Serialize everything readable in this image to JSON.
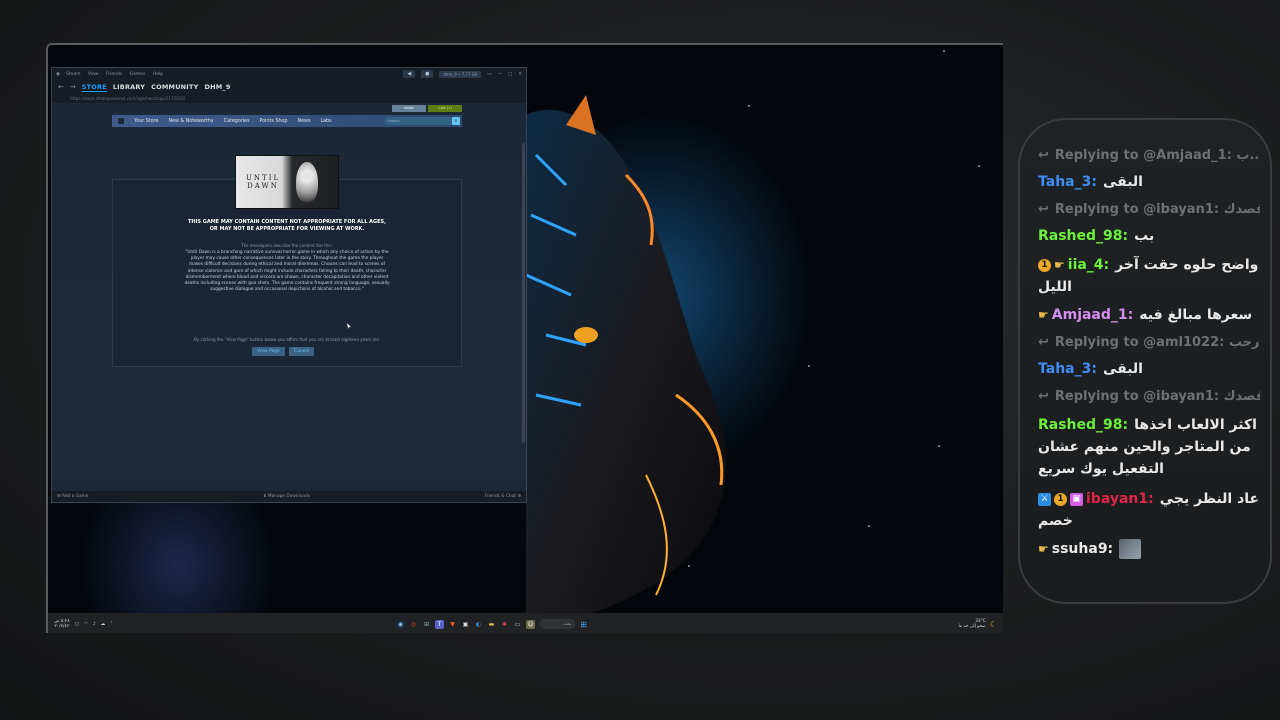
{
  "steam": {
    "menu": [
      "Steam",
      "View",
      "Friends",
      "Games",
      "Help"
    ],
    "user_chip": "dhm_9 • 7,77 SR",
    "nav": [
      "STORE",
      "LIBRARY",
      "COMMUNITY",
      "DHM_9"
    ],
    "url": "https://store.steampowered.com/agecheck/app/2172010/",
    "top_buttons": {
      "install": "Install",
      "cart": "Cart (1)"
    },
    "storenav": [
      "Your Store",
      "New & Noteworthy",
      "Categories",
      "Points Shop",
      "News",
      "Labs"
    ],
    "search_placeholder": "search",
    "game_logo": "UNTIL DAWN",
    "warning_line1": "THIS GAME MAY CONTAIN CONTENT NOT APPROPRIATE FOR ALL AGES,",
    "warning_line2": "OR MAY NOT BE APPROPRIATE FOR VIEWING AT WORK.",
    "desc_head": "The developers describe the content like this:",
    "description": "\"Until Dawn is a branching narrative survival horror game in which any choice of action by the player may cause other consequences later in the story. Throughout the game the player makes difficult decisions during ethical and moral dilemmas. Choices can lead to scenes of intense violence and gore of which might include characters falling to their death, character dismemberment where blood and viscera are shown, character decapitation and other violent deaths including scenes with gun shots. The game contains frequent strong language, sexually suggestive dialogue and occasional depictions of alcohol and tobacco.\"",
    "affirm": "By clicking the \"View Page\" button below you affirm that you are at least eighteen years old.",
    "view_page": "View Page",
    "cancel": "Cancel",
    "bottom_left": "Add a Game",
    "bottom_mid": "Manage Downloads",
    "bottom_right": "Friends & Chat"
  },
  "taskbar": {
    "time": "٥:٢٨ ص",
    "date": "٢٠/٨/٤٢",
    "search_text": "بحث",
    "weather_temp": "33°C",
    "weather_desc": "صحو إلى حد ما"
  },
  "chat": {
    "lines": [
      {
        "type": "reply",
        "text": "Replying to @Amjaad_1: ب..."
      },
      {
        "type": "msg",
        "user": "Taha_3:",
        "color": "#3d8df5",
        "msg": "البقى",
        "badges": []
      },
      {
        "type": "reply",
        "text": "Replying to @ibayan1: قصدك..."
      },
      {
        "type": "msg",
        "user": "Rashed_98:",
        "color": "#6cf23a",
        "msg": "بب",
        "badges": []
      },
      {
        "type": "msg",
        "user": "iia_4:",
        "color": "#6cf23a",
        "msg": "واضح حلوه حقت آخر الليل",
        "badges": [
          "one",
          "hand"
        ],
        "wrap": true
      },
      {
        "type": "msg",
        "user": "Amjaad_1:",
        "color": "#d58ef0",
        "msg": "سعرها مبالغ فيه",
        "badges": [
          "hand"
        ]
      },
      {
        "type": "reply",
        "text": "Replying to @aml1022: ارحب..."
      },
      {
        "type": "msg",
        "user": "Taha_3:",
        "color": "#3d8df5",
        "msg": "البقى",
        "badges": []
      },
      {
        "type": "reply",
        "text": "Replying to @ibayan1: قصدك..."
      },
      {
        "type": "msg",
        "user": "Rashed_98:",
        "color": "#6cf23a",
        "msg": "اكثر الالعاب اخذها من المتاجر والحين منهم عشان التفعيل يوك سريع",
        "badges": [],
        "wrap": true
      },
      {
        "type": "msg",
        "user": "ibayan1:",
        "color": "#e02547",
        "msg": "عاد النظر يجي خصم",
        "badges": [
          "sword",
          "one",
          "gift"
        ],
        "wrap": true
      },
      {
        "type": "msg",
        "user": "ssuha9:",
        "color": "#e8e8e8",
        "msg": "",
        "badges": [
          "hand"
        ],
        "avatar": true
      }
    ]
  }
}
